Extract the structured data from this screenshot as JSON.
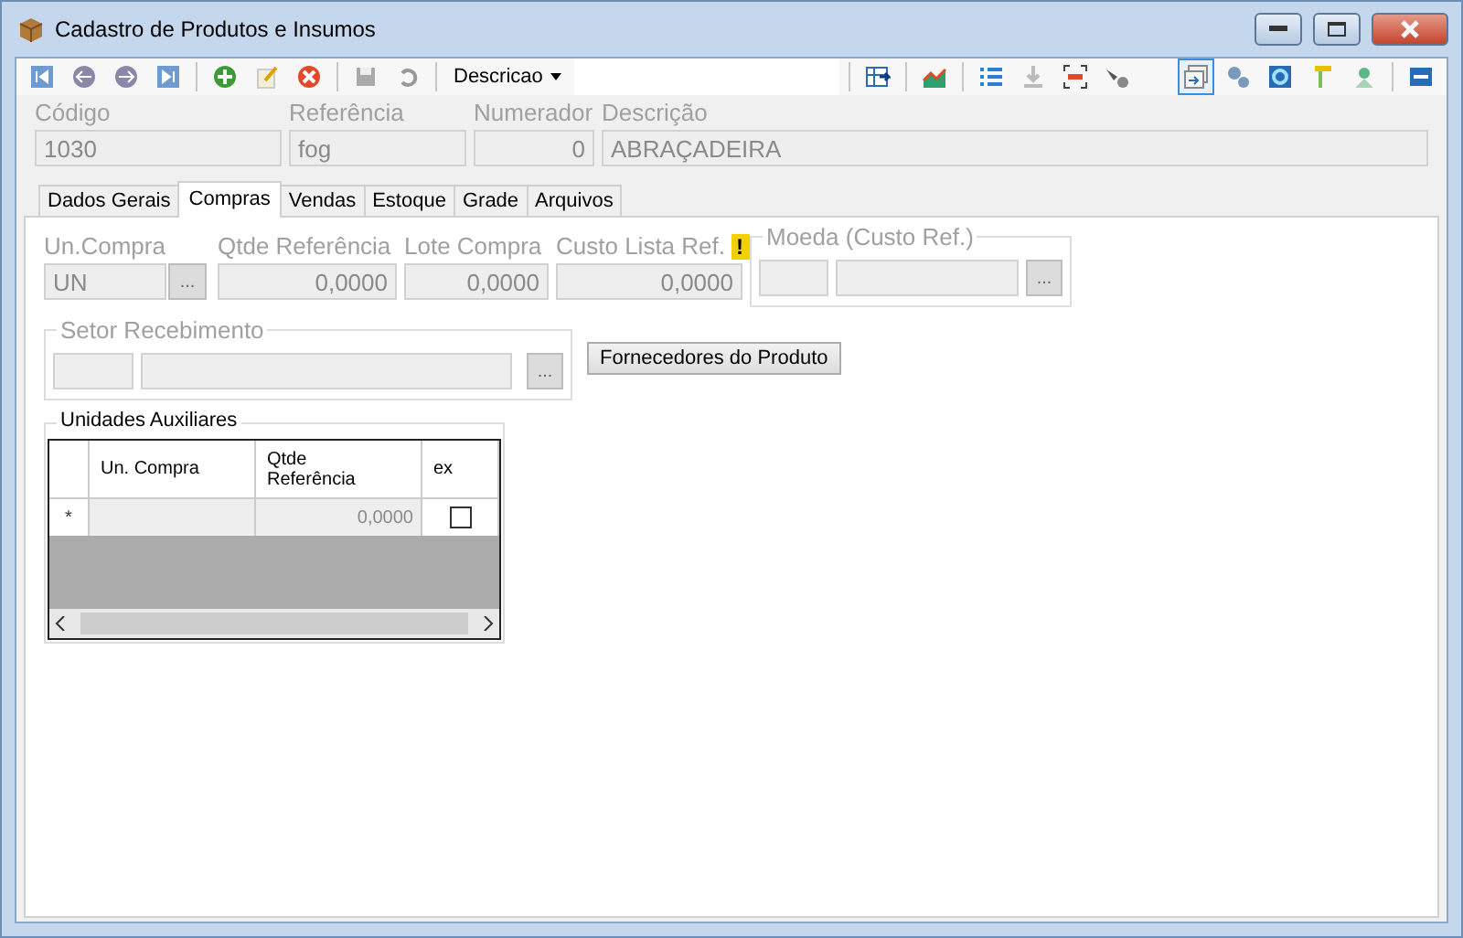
{
  "window": {
    "title": "Cadastro de Produtos e Insumos"
  },
  "toolbar": {
    "left_tools": [
      {
        "kind": "first",
        "selected": false
      },
      {
        "kind": "prev",
        "selected": false
      },
      {
        "kind": "next",
        "selected": false
      },
      {
        "kind": "last",
        "selected": false
      },
      {
        "kind": "sep"
      },
      {
        "kind": "add",
        "selected": false
      },
      {
        "kind": "edit",
        "selected": false
      },
      {
        "kind": "delete",
        "selected": false
      },
      {
        "kind": "sep"
      },
      {
        "kind": "save",
        "selected": false
      },
      {
        "kind": "undo",
        "selected": false
      },
      {
        "kind": "sep"
      }
    ],
    "search_by": "Descricao",
    "right_tools": [
      {
        "kind": "sep"
      },
      {
        "kind": "grid",
        "selected": false
      },
      {
        "kind": "sep"
      },
      {
        "kind": "chart",
        "selected": false
      },
      {
        "kind": "sep"
      },
      {
        "kind": "list",
        "selected": false
      },
      {
        "kind": "download",
        "selected": false
      },
      {
        "kind": "barcode",
        "selected": false
      },
      {
        "kind": "tool",
        "selected": false
      },
      {
        "kind": "gap"
      },
      {
        "kind": "window",
        "selected": true
      },
      {
        "kind": "gears",
        "selected": false
      },
      {
        "kind": "refresh",
        "selected": false
      },
      {
        "kind": "flag",
        "selected": false
      },
      {
        "kind": "pin",
        "selected": false
      },
      {
        "kind": "sep"
      },
      {
        "kind": "panel",
        "selected": false
      }
    ]
  },
  "header": [
    {
      "label": "Código",
      "value": "1030",
      "kind": "text"
    },
    {
      "label": "Referência",
      "value": "fog",
      "kind": "text"
    },
    {
      "label": "Numerador",
      "value": "0",
      "kind": "number"
    },
    {
      "label": "Descrição",
      "value": "ABRAÇADEIRA",
      "kind": "text"
    }
  ],
  "tabs": [
    {
      "label": "Dados Gerais",
      "selected": false
    },
    {
      "label": "Compras",
      "selected": true
    },
    {
      "label": "Vendas",
      "selected": false
    },
    {
      "label": "Estoque",
      "selected": false
    },
    {
      "label": "Grade",
      "selected": false
    },
    {
      "label": "Arquivos",
      "selected": false
    }
  ],
  "compras": {
    "fields": [
      {
        "label": "Un.Compra",
        "value": "UN",
        "kind": "lookup",
        "warning": false
      },
      {
        "label": "Qtde Referência",
        "value": "0,0000",
        "kind": "number",
        "warning": false
      },
      {
        "label": "Lote Compra",
        "value": "0,0000",
        "kind": "number",
        "warning": false
      },
      {
        "label": "Custo Lista Ref.",
        "value": "0,0000",
        "kind": "number",
        "warning": true,
        "warning_mark": "!"
      }
    ],
    "moeda": {
      "title": "Moeda (Custo Ref.)",
      "button": "..."
    },
    "lookup_button": "...",
    "setor": {
      "title": "Setor Recebimento",
      "button": "..."
    },
    "fornecedores_button": "Fornecedores do Produto",
    "unidades": {
      "title": "Unidades Auxiliares",
      "columns": [
        "Un. Compra",
        "Qtde\nReferência",
        "ex"
      ],
      "rows": [
        {
          "marker": "*",
          "un_compra": "",
          "qtde": "0,0000",
          "ex_checked": false
        }
      ]
    }
  }
}
